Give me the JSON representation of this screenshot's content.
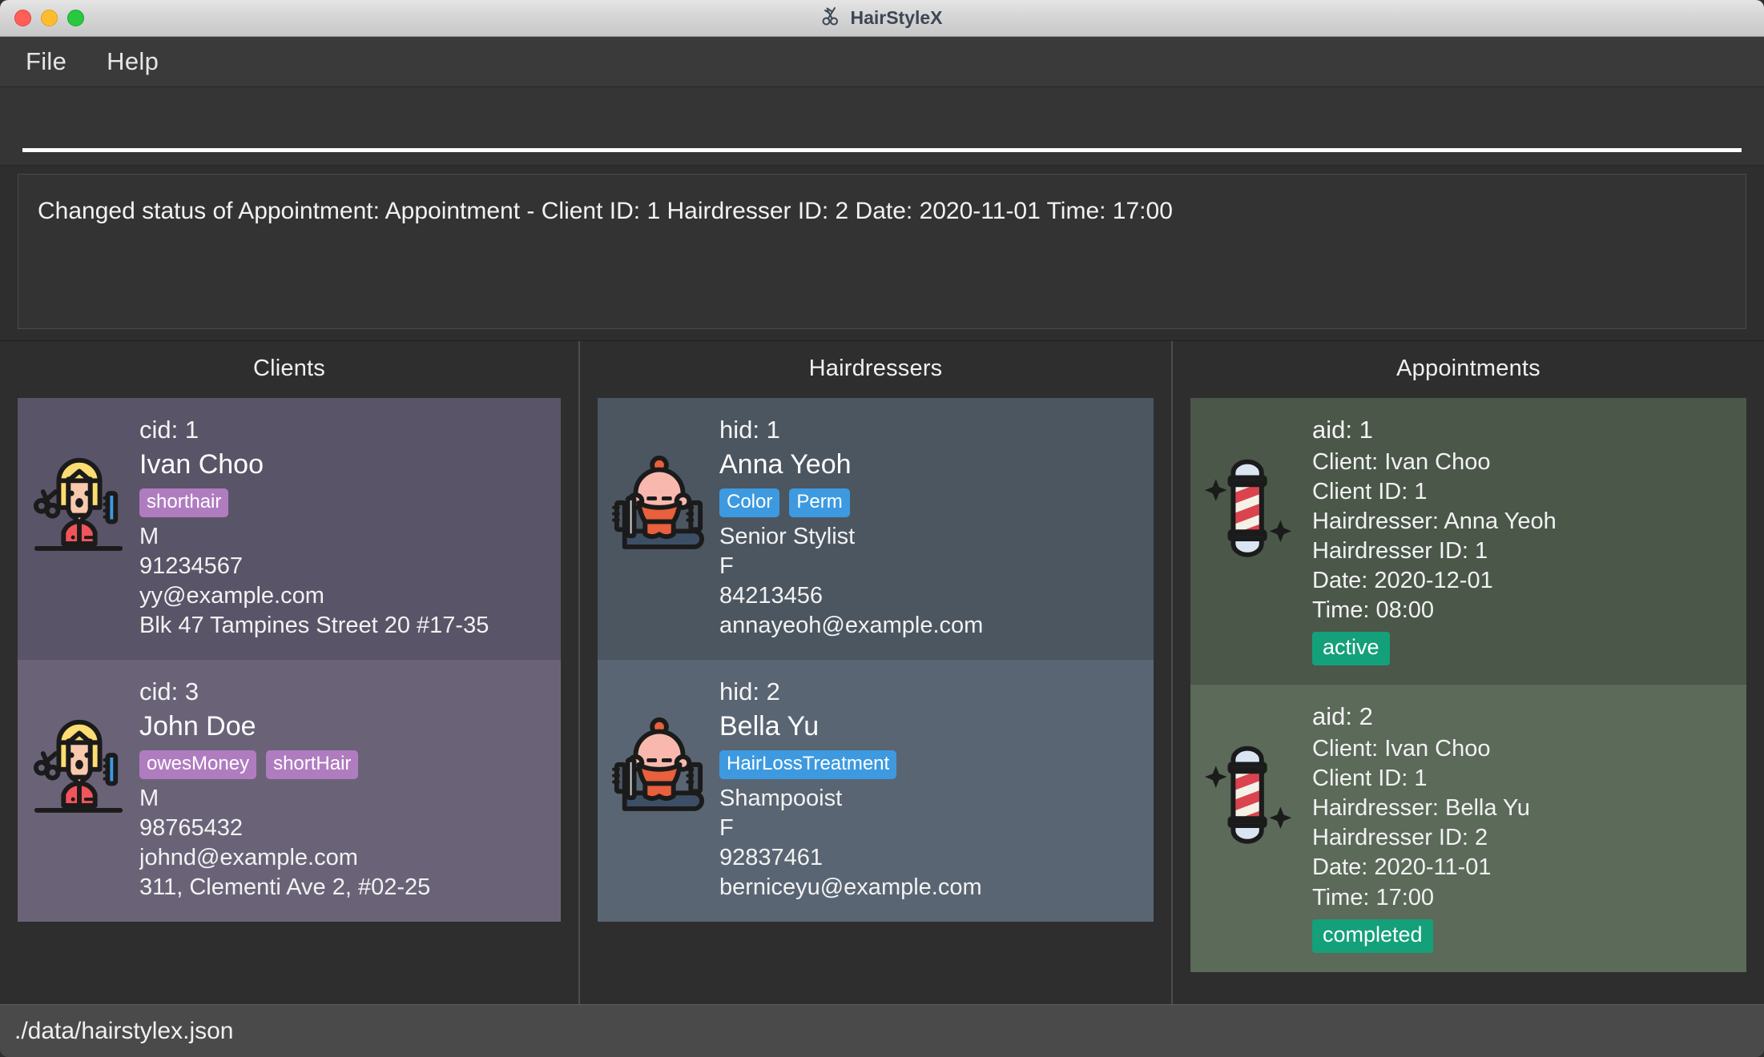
{
  "window": {
    "title": "HairStyleX",
    "title_icon": "scissors-comb-icon"
  },
  "menubar": {
    "items": [
      {
        "label": "File"
      },
      {
        "label": "Help"
      }
    ]
  },
  "command": {
    "value": "",
    "placeholder": ""
  },
  "result": {
    "text": "Changed status of Appointment: Appointment - Client ID: 1 Hairdresser ID: 2 Date: 2020-11-01 Time: 17:00"
  },
  "panels": {
    "clients": {
      "title": "Clients",
      "cards": [
        {
          "icon": "client-avatar-icon",
          "id_label": "cid: 1",
          "name": "Ivan Choo",
          "tags": [
            "shorthair"
          ],
          "gender": "M",
          "phone": "91234567",
          "email": "yy@example.com",
          "address": "Blk 47 Tampines Street 20 #17-35"
        },
        {
          "icon": "client-avatar-icon",
          "id_label": "cid: 3",
          "name": "John Doe",
          "tags": [
            "owesMoney",
            "shortHair"
          ],
          "gender": "M",
          "phone": "98765432",
          "email": "johnd@example.com",
          "address": "311, Clementi Ave 2, #02-25"
        }
      ]
    },
    "hairdressers": {
      "title": "Hairdressers",
      "cards": [
        {
          "icon": "hairdresser-avatar-icon",
          "id_label": "hid: 1",
          "name": "Anna Yeoh",
          "tags": [
            "Color",
            "Perm"
          ],
          "title_role": "Senior Stylist",
          "gender": "F",
          "phone": "84213456",
          "email": "annayeoh@example.com"
        },
        {
          "icon": "hairdresser-avatar-icon",
          "id_label": "hid: 2",
          "name": "Bella Yu",
          "tags": [
            "HairLossTreatment"
          ],
          "title_role": "Shampooist",
          "gender": "F",
          "phone": "92837461",
          "email": "berniceyu@example.com"
        }
      ]
    },
    "appointments": {
      "title": "Appointments",
      "cards": [
        {
          "icon": "barber-pole-icon",
          "id_label": "aid: 1",
          "client": "Client: Ivan Choo",
          "client_id": "Client ID: 1",
          "hairdresser": "Hairdresser: Anna Yeoh",
          "hairdresser_id": "Hairdresser ID: 1",
          "date": "Date: 2020-12-01",
          "time": "Time: 08:00",
          "status": "active"
        },
        {
          "icon": "barber-pole-icon",
          "id_label": "aid: 2",
          "client": "Client: Ivan Choo",
          "client_id": "Client ID: 1",
          "hairdresser": "Hairdresser: Bella Yu",
          "hairdresser_id": "Hairdresser ID: 2",
          "date": "Date: 2020-11-01",
          "time": "Time: 17:00",
          "status": "completed"
        }
      ]
    }
  },
  "statusbar": {
    "path": "./data/hairstylex.json"
  },
  "colors": {
    "tag_client": "#b07cc0",
    "tag_hairdresser": "#3d9ae0",
    "status_badge": "#14a07a",
    "client_card": "#5a5468",
    "hairdresser_card": "#4c5661",
    "appointment_card": "#4a5749"
  }
}
